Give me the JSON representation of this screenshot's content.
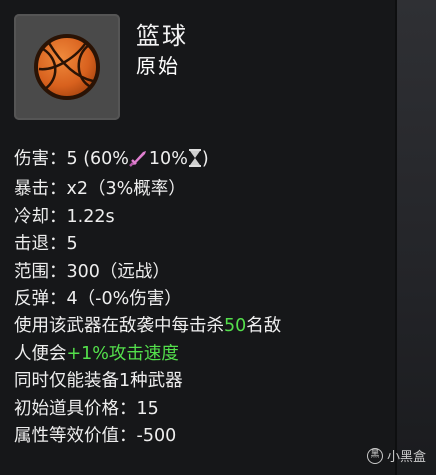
{
  "item": {
    "name": "篮球",
    "rarity": "原始",
    "icon": "basketball-icon"
  },
  "stats": {
    "damage_label": "伤害：",
    "damage_value": "5 (60%",
    "damage_melee_icon": "sword-icon",
    "damage_value_2": "10%",
    "damage_ranged_icon": "hourglass-icon",
    "damage_value_3": ")",
    "crit_label": "暴击：",
    "crit_value": "x2（3%概率）",
    "cooldown_label": "冷却：",
    "cooldown_value": "1.22s",
    "knockback_label": "击退：",
    "knockback_value": "5",
    "range_label": "范围：",
    "range_value": "300（远战）",
    "bounce_label": "反弹：",
    "bounce_value": "4（-0%伤害）",
    "effect_line1_a": "使用该武器在敌袭中每击杀",
    "effect_line1_num": "50",
    "effect_line1_b": "名敌",
    "effect_line2_a": "人便会",
    "effect_line2_bonus": "+1%攻击速度",
    "unique_note": "同时仅能装备1种武器",
    "base_price_label": "初始道具价格：",
    "base_price_value": "15",
    "stat_value_label": "属性等效价值：",
    "stat_value_value": "-500"
  },
  "watermark": {
    "text": "小黑盒",
    "logo_glyph": "黑"
  },
  "colors": {
    "bonus_green": "#54e04c",
    "panel": "#161719",
    "icon_frame": "#4a4a4a",
    "sword_pink": "#e07fd0"
  }
}
